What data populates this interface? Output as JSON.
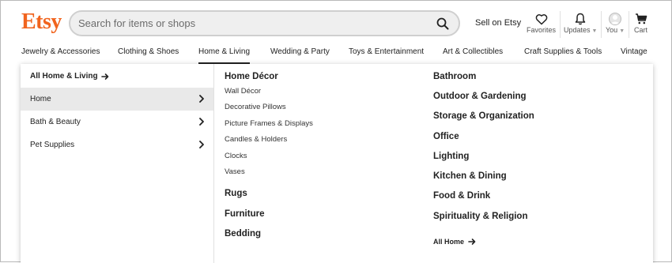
{
  "brand": {
    "logo": "Etsy",
    "color": "#F1641E"
  },
  "search": {
    "placeholder": "Search for items or shops",
    "value": ""
  },
  "header": {
    "sell": "Sell on Etsy",
    "favorites": "Favorites",
    "updates": "Updates",
    "you": "You",
    "cart": "Cart"
  },
  "categories": [
    "Jewelry & Accessories",
    "Clothing & Shoes",
    "Home & Living",
    "Wedding & Party",
    "Toys & Entertainment",
    "Art & Collectibles",
    "Craft Supplies & Tools",
    "Vintage"
  ],
  "active_category": "Home & Living",
  "dropdown": {
    "all_link": "All Home & Living",
    "subcategories": [
      "Home",
      "Bath & Beauty",
      "Pet Supplies"
    ],
    "active_subcategory": "Home",
    "home_decor": {
      "heading": "Home Décor",
      "links": [
        "Wall Décor",
        "Decorative Pillows",
        "Picture Frames & Displays",
        "Candles & Holders",
        "Clocks",
        "Vases"
      ]
    },
    "col2_headings": [
      "Rugs",
      "Furniture",
      "Bedding"
    ],
    "col3_headings": [
      "Bathroom",
      "Outdoor & Gardening",
      "Storage & Organization",
      "Office",
      "Lighting",
      "Kitchen & Dining",
      "Food & Drink",
      "Spirituality & Religion"
    ],
    "all_home": "All Home"
  }
}
